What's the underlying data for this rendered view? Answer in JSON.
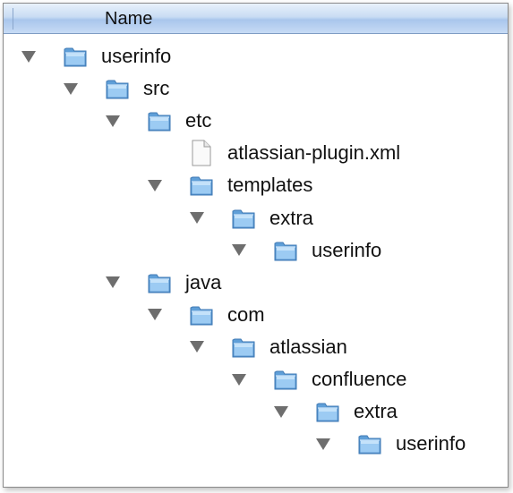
{
  "header": {
    "column_name": "Name"
  },
  "tree": [
    {
      "label": "userinfo",
      "type": "folder",
      "depth": 0,
      "expanded": true
    },
    {
      "label": "src",
      "type": "folder",
      "depth": 1,
      "expanded": true
    },
    {
      "label": "etc",
      "type": "folder",
      "depth": 2,
      "expanded": true
    },
    {
      "label": "atlassian-plugin.xml",
      "type": "file",
      "depth": 3,
      "expanded": false
    },
    {
      "label": "templates",
      "type": "folder",
      "depth": 3,
      "expanded": true
    },
    {
      "label": "extra",
      "type": "folder",
      "depth": 4,
      "expanded": true
    },
    {
      "label": "userinfo",
      "type": "folder",
      "depth": 5,
      "expanded": true
    },
    {
      "label": "java",
      "type": "folder",
      "depth": 2,
      "expanded": true
    },
    {
      "label": "com",
      "type": "folder",
      "depth": 3,
      "expanded": true
    },
    {
      "label": "atlassian",
      "type": "folder",
      "depth": 4,
      "expanded": true
    },
    {
      "label": "confluence",
      "type": "folder",
      "depth": 5,
      "expanded": true
    },
    {
      "label": "extra",
      "type": "folder",
      "depth": 6,
      "expanded": true
    },
    {
      "label": "userinfo",
      "type": "folder",
      "depth": 7,
      "expanded": true
    }
  ],
  "colors": {
    "header_gradient_top": "#e8f1fb",
    "header_gradient_bottom": "#a9c6ec",
    "folder_blue": "#8cc0ee",
    "disclosure_gray": "#6e6e6e"
  },
  "icons": {
    "folder": "folder-icon",
    "file": "document-icon",
    "disclosure": "disclosure-triangle-icon"
  }
}
